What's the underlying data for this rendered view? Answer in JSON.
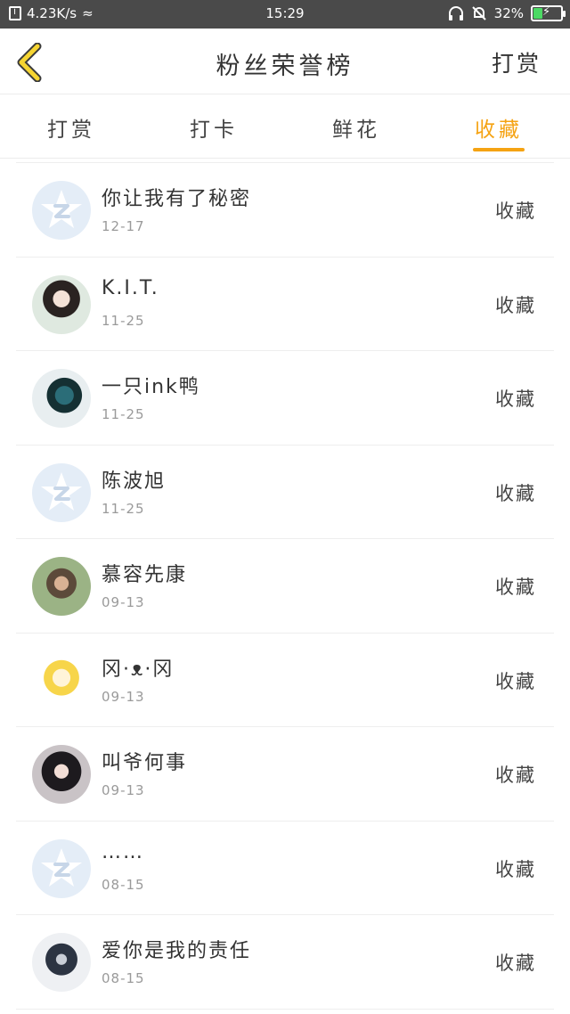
{
  "status_bar": {
    "speed": "4.23K/s",
    "time": "15:29",
    "battery_percent": "32%",
    "battery_level": 0.32
  },
  "header": {
    "title": "粉丝荣誉榜",
    "right_action": "打赏",
    "back_icon": "chevron-left-icon",
    "accent_color": "#f5a313"
  },
  "tabs": [
    {
      "label": "打赏",
      "active": false
    },
    {
      "label": "打卡",
      "active": false
    },
    {
      "label": "鲜花",
      "active": false
    },
    {
      "label": "收藏",
      "active": true
    }
  ],
  "list": [
    {
      "name": "你让我有了秘密",
      "date": "12-17",
      "action": "收藏",
      "avatar": "default"
    },
    {
      "name": "K.I.T.",
      "date": "11-25",
      "action": "收藏",
      "avatar": "photo1"
    },
    {
      "name": "一只ink鸭",
      "date": "11-25",
      "action": "收藏",
      "avatar": "photo2"
    },
    {
      "name": "陈波旭",
      "date": "11-25",
      "action": "收藏",
      "avatar": "default"
    },
    {
      "name": "慕容先康",
      "date": "09-13",
      "action": "收藏",
      "avatar": "photo3"
    },
    {
      "name": "冈·ᴥ·冈",
      "date": "09-13",
      "action": "收藏",
      "avatar": "photo4"
    },
    {
      "name": "叫爷何事",
      "date": "09-13",
      "action": "收藏",
      "avatar": "photo5"
    },
    {
      "name": "……",
      "date": "08-15",
      "action": "收藏",
      "avatar": "default"
    },
    {
      "name": "爱你是我的责任",
      "date": "08-15",
      "action": "收藏",
      "avatar": "photo6"
    }
  ]
}
